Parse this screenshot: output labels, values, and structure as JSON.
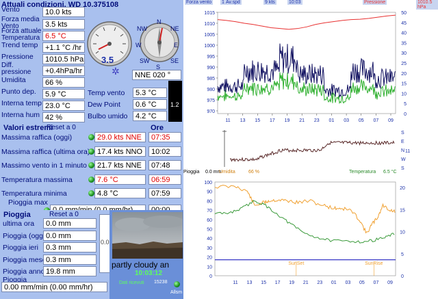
{
  "header": {
    "title": "Attuali condizioni, WD 10.375108"
  },
  "current": [
    {
      "label": "Vento",
      "value": "10.0 kts"
    },
    {
      "label": "Forza media Vento",
      "value": "3.5 kts"
    },
    {
      "label": "Forza attuale Temperatura",
      "value": "6.5 °C"
    },
    {
      "label": "Trend temp",
      "value": "+1.1 °C /hr"
    },
    {
      "label": "Pressione",
      "value": "1010.5 hPa"
    },
    {
      "label": "Diff. pressione",
      "value": "+0.4hPa/hr"
    },
    {
      "label": "Umidita",
      "value": "66 %"
    },
    {
      "label": "Punto dep.",
      "value": "5.9 °C"
    },
    {
      "label": "Interna temp",
      "value": "23.0 °C"
    },
    {
      "label": "Interna hum",
      "value": "42 %"
    }
  ],
  "right_vals": [
    {
      "label": "Temp vento",
      "value": "5.3 °C"
    },
    {
      "label": "Dew Point",
      "value": "0.6 °C"
    },
    {
      "label": "Bulbo umido",
      "value": "4.2 °C"
    }
  ],
  "gauge": {
    "value": "3.5",
    "direction": "NNE  020 °",
    "compass": [
      "N",
      "NE",
      "E",
      "SE",
      "S",
      "SW",
      "W",
      "NW"
    ],
    "uv": "1.2"
  },
  "extremes": {
    "title": "Valori estremi",
    "reset": "Reset a 0",
    "ore": "Ore",
    "rows": [
      {
        "label": "Massima raffica (oggi)",
        "value": "29.0 kts NNE",
        "time": "07:35",
        "red": true
      },
      {
        "label": "Massima raffica (ultima ora)",
        "value": "17.4 kts NNO",
        "time": "10:02",
        "red": false
      },
      {
        "label": "Massimo vento in 1 minuto",
        "value": "21.7 kts NNE",
        "time": "07:48",
        "red": false
      },
      {
        "label": "Temperatura massima",
        "value": "7.6 °C",
        "time": "06:59",
        "red": true
      },
      {
        "label": "Temperatura minima",
        "value": "4.8 °C",
        "time": "07:59",
        "red": false
      },
      {
        "label": "Pioggia max",
        "value": "0.0 mm/min (0.0 mm/hr)",
        "time": "00:00",
        "red": false
      }
    ]
  },
  "rain": {
    "title": "Pioggia",
    "reset": "Reset a 0",
    "gauge_value": "0.0",
    "rows": [
      {
        "label": "ultima ora",
        "value": "0.0 mm"
      },
      {
        "label": "Pioggia (oggi)",
        "value": "0.0 mm"
      },
      {
        "label": "Pioggia ieri",
        "value": "0.3 mm"
      },
      {
        "label": "Pioggia mese",
        "value": "0.3 mm"
      },
      {
        "label": "Pioggia anno",
        "value": "19.8 mm"
      }
    ],
    "rate_label": "Pioggia",
    "rate_value": "0.00 mm/min (0.00 mm/hr)"
  },
  "webcam": {
    "caption": "partly cloudy an",
    "time": "10:03:12",
    "received_label": "Dati ricevuti",
    "received_count": "15238",
    "alarm_label": "Allsm"
  },
  "chart_top": {
    "legend": [
      {
        "label": "Forza vento",
        "value": "17 kts"
      },
      {
        "label": "Av.spd",
        "value": "9 kts"
      },
      {
        "label": "",
        "value": "10:03"
      },
      {
        "label": "Pressione",
        "value": "1010.5 hPa"
      }
    ],
    "left_ticks": [
      "1015",
      "1010",
      "1005",
      "1000",
      "995",
      "990",
      "985",
      "980",
      "975",
      "970"
    ],
    "right_ticks": [
      "50",
      "45",
      "40",
      "35",
      "30",
      "25",
      "20",
      "15",
      "10",
      "5",
      "0"
    ],
    "x_ticks": [
      "11",
      "13",
      "15",
      "17",
      "19",
      "21",
      "23",
      "01",
      "03",
      "05",
      "07",
      "09"
    ],
    "colors": {
      "pressure": "#e83030",
      "gust": "#101060",
      "avg": "#30b030"
    }
  },
  "chart_mid": {
    "dir_ticks": [
      "S",
      "E",
      "N",
      "W",
      "S"
    ],
    "dir_right": "11"
  },
  "mid_labels": {
    "rain": "Pioggia",
    "rain_value": "0.0 mm",
    "hum": "Umidita",
    "hum_value": "66 %",
    "temp": "Temperatura",
    "temp_value": "6.5 °C"
  },
  "chart_bot": {
    "left_ticks": [
      "100",
      "90",
      "80",
      "70",
      "60",
      "50",
      "40",
      "30",
      "20",
      "10",
      "0"
    ],
    "right_ticks": [
      "20",
      "15",
      "10",
      "5",
      "0"
    ],
    "x_ticks": [
      "11",
      "13",
      "15",
      "17",
      "19",
      "21",
      "23",
      "01",
      "03",
      "05",
      "07",
      "09"
    ],
    "sunset": "SunSet",
    "sunrise": "SunRise",
    "colors": {
      "humidity": "#f0a030",
      "temperature": "#3a9a3a",
      "rain": "#2020c0"
    }
  }
}
